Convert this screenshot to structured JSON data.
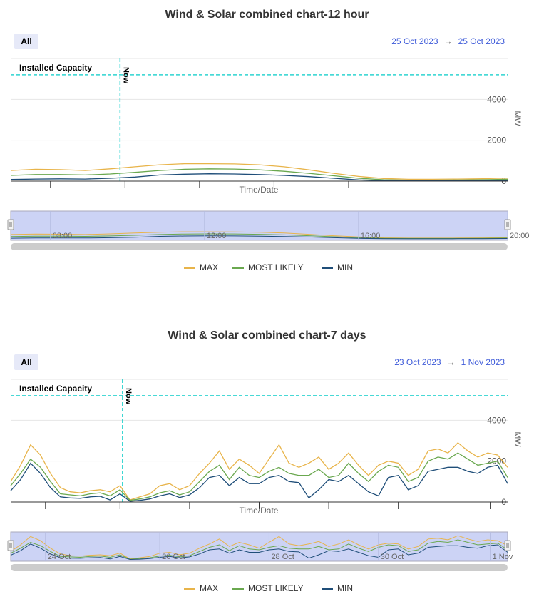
{
  "charts": [
    {
      "title": "Wind & Solar combined chart-12 hour",
      "all_label": "All",
      "range_from": "25 Oct 2023",
      "range_to": "25 Oct 2023",
      "range_arrow": "→",
      "installed_capacity_label": "Installed Capacity",
      "now_label": "Now",
      "xlabel": "Time/Date",
      "ylabel": "MW",
      "nav_ticks": [
        "08:00",
        "12:00",
        "16:00",
        "20:00"
      ]
    },
    {
      "title": "Wind & Solar combined chart-7 days",
      "all_label": "All",
      "range_from": "23 Oct 2023",
      "range_to": "1 Nov 2023",
      "range_arrow": "→",
      "installed_capacity_label": "Installed Capacity",
      "now_label": "Now",
      "xlabel": "Time/Date",
      "ylabel": "MW",
      "nav_ticks": [
        "24 Oct",
        "26 Oct",
        "28 Oct",
        "30 Oct",
        "1 Nov"
      ]
    }
  ],
  "legend": [
    {
      "label": "MAX",
      "color": "#e8b44a"
    },
    {
      "label": "MOST LIKELY",
      "color": "#6aa84f"
    },
    {
      "label": "MIN",
      "color": "#1f4e79"
    }
  ],
  "chart_data": [
    {
      "type": "line",
      "title": "Wind & Solar combined chart-12 hour",
      "xlabel": "Time/Date",
      "ylabel": "MW",
      "ylim": [
        0,
        6000
      ],
      "yticks": [
        0,
        2000,
        4000
      ],
      "installed_capacity": 5200,
      "now_x": 0.22,
      "x": [
        0,
        0.05,
        0.1,
        0.15,
        0.2,
        0.25,
        0.3,
        0.35,
        0.4,
        0.45,
        0.5,
        0.55,
        0.6,
        0.65,
        0.7,
        0.75,
        0.8,
        0.85,
        0.9,
        0.95,
        1.0
      ],
      "series": [
        {
          "name": "MAX",
          "values": [
            520,
            580,
            560,
            520,
            600,
            700,
            800,
            850,
            850,
            840,
            800,
            700,
            550,
            380,
            230,
            130,
            90,
            90,
            100,
            120,
            150
          ]
        },
        {
          "name": "MOST LIKELY",
          "values": [
            280,
            320,
            320,
            300,
            350,
            430,
            520,
            580,
            600,
            590,
            550,
            480,
            380,
            260,
            140,
            70,
            50,
            50,
            55,
            70,
            90
          ]
        },
        {
          "name": "MIN",
          "values": [
            80,
            100,
            110,
            100,
            140,
            200,
            300,
            340,
            360,
            350,
            320,
            280,
            220,
            140,
            60,
            20,
            10,
            10,
            15,
            25,
            40
          ]
        }
      ]
    },
    {
      "type": "line",
      "title": "Wind & Solar combined chart-7 days",
      "xlabel": "Time/Date",
      "ylabel": "MW",
      "ylim": [
        0,
        6000
      ],
      "yticks": [
        0,
        2000,
        4000
      ],
      "installed_capacity": 5200,
      "now_x": 0.225,
      "x": [
        0,
        0.02,
        0.04,
        0.06,
        0.08,
        0.1,
        0.12,
        0.14,
        0.16,
        0.18,
        0.2,
        0.22,
        0.24,
        0.26,
        0.28,
        0.3,
        0.32,
        0.34,
        0.36,
        0.38,
        0.4,
        0.42,
        0.44,
        0.46,
        0.48,
        0.5,
        0.52,
        0.54,
        0.56,
        0.58,
        0.6,
        0.62,
        0.64,
        0.66,
        0.68,
        0.7,
        0.72,
        0.74,
        0.76,
        0.78,
        0.8,
        0.82,
        0.84,
        0.86,
        0.88,
        0.9,
        0.92,
        0.94,
        0.96,
        0.98,
        1.0
      ],
      "series": [
        {
          "name": "MAX",
          "values": [
            1000,
            1800,
            2800,
            2300,
            1400,
            700,
            500,
            450,
            550,
            600,
            500,
            800,
            100,
            250,
            400,
            800,
            900,
            600,
            800,
            1400,
            1900,
            2500,
            1600,
            2100,
            1800,
            1400,
            2100,
            2800,
            1900,
            1700,
            1900,
            2200,
            1600,
            1900,
            2400,
            1800,
            1300,
            1800,
            2000,
            1900,
            1300,
            1600,
            2500,
            2600,
            2400,
            2900,
            2500,
            2200,
            2400,
            2300,
            1700
          ]
        },
        {
          "name": "MOST LIKELY",
          "values": [
            800,
            1400,
            2100,
            1700,
            1000,
            400,
            350,
            300,
            400,
            450,
            300,
            600,
            80,
            150,
            250,
            450,
            550,
            350,
            500,
            1000,
            1500,
            1800,
            1100,
            1700,
            1300,
            1200,
            1500,
            1700,
            1400,
            1300,
            1300,
            1600,
            1200,
            1300,
            1900,
            1400,
            1000,
            1500,
            1800,
            1700,
            1000,
            1200,
            2000,
            2200,
            2100,
            2400,
            2100,
            1800,
            1900,
            2000,
            1200
          ]
        },
        {
          "name": "MIN",
          "values": [
            550,
            1100,
            1900,
            1400,
            700,
            250,
            200,
            180,
            250,
            280,
            100,
            400,
            40,
            80,
            150,
            300,
            400,
            220,
            350,
            700,
            1200,
            1300,
            800,
            1200,
            900,
            900,
            1200,
            1300,
            1000,
            950,
            200,
            600,
            1100,
            1000,
            1300,
            900,
            500,
            300,
            1200,
            1300,
            600,
            800,
            1500,
            1600,
            1700,
            1700,
            1500,
            1400,
            1700,
            1800,
            900
          ]
        }
      ]
    }
  ]
}
